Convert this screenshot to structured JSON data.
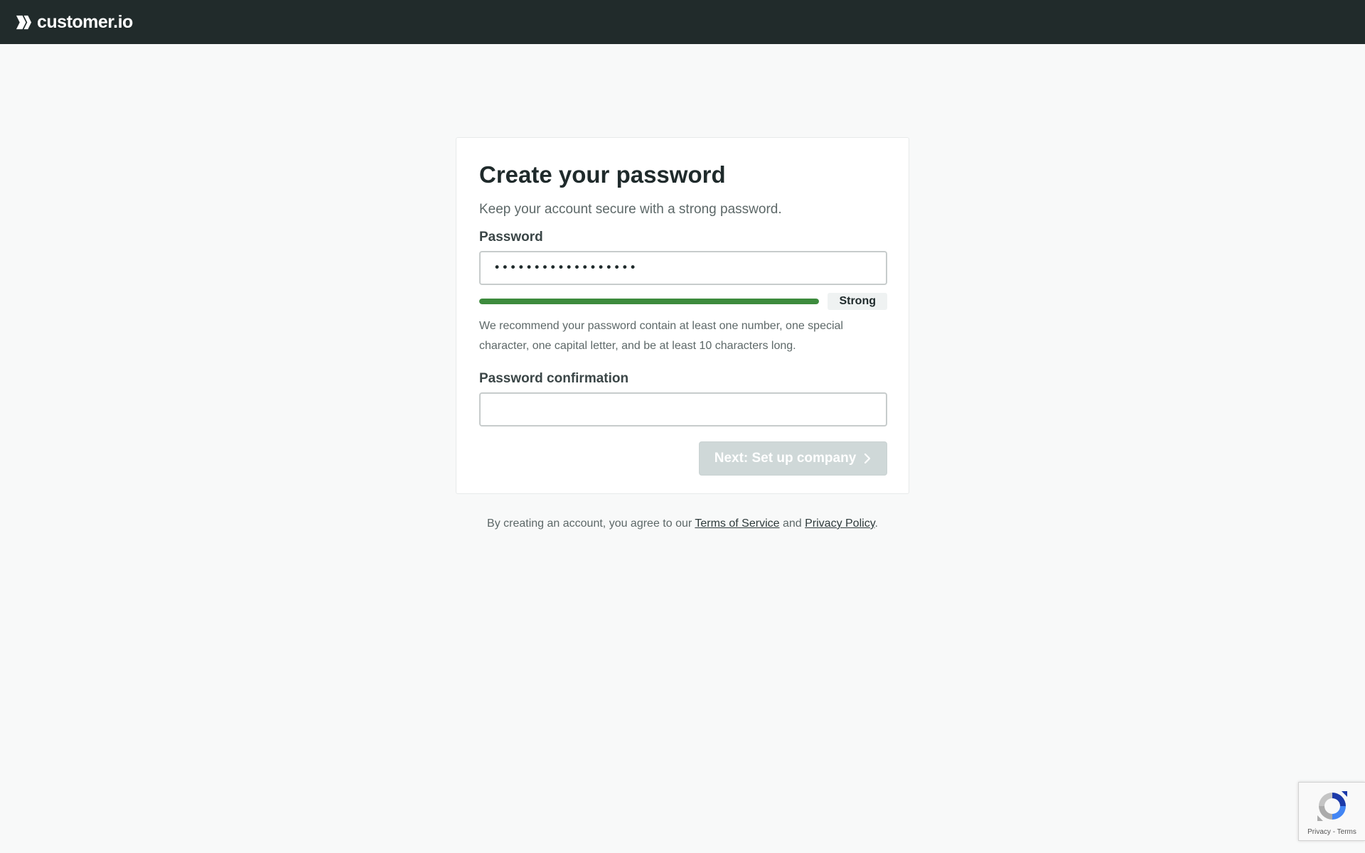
{
  "header": {
    "logo_text": "customer.io",
    "background": "#212b2b"
  },
  "form": {
    "title": "Create your password",
    "subtitle": "Keep your account secure with a strong password.",
    "password_label": "Password",
    "password_value": "••••••••••••••••••",
    "strength": {
      "label": "Strong",
      "level": 1.0,
      "color": "#3d8b3d"
    },
    "hint": "We recommend your password contain at least one number, one special character, one capital letter, and be at least 10 characters long.",
    "confirmation_label": "Password confirmation",
    "confirmation_value": "",
    "next_button_label": "Next: Set up company",
    "next_button_icon": "chevron-right-icon"
  },
  "legal": {
    "prefix": "By creating an account, you agree to our ",
    "terms_link": "Terms of Service",
    "middle": " and ",
    "privacy_link": "Privacy Policy",
    "suffix": "."
  },
  "recaptcha": {
    "icon": "recaptcha-icon",
    "privacy_label": "Privacy",
    "separator": " - ",
    "terms_label": "Terms"
  }
}
